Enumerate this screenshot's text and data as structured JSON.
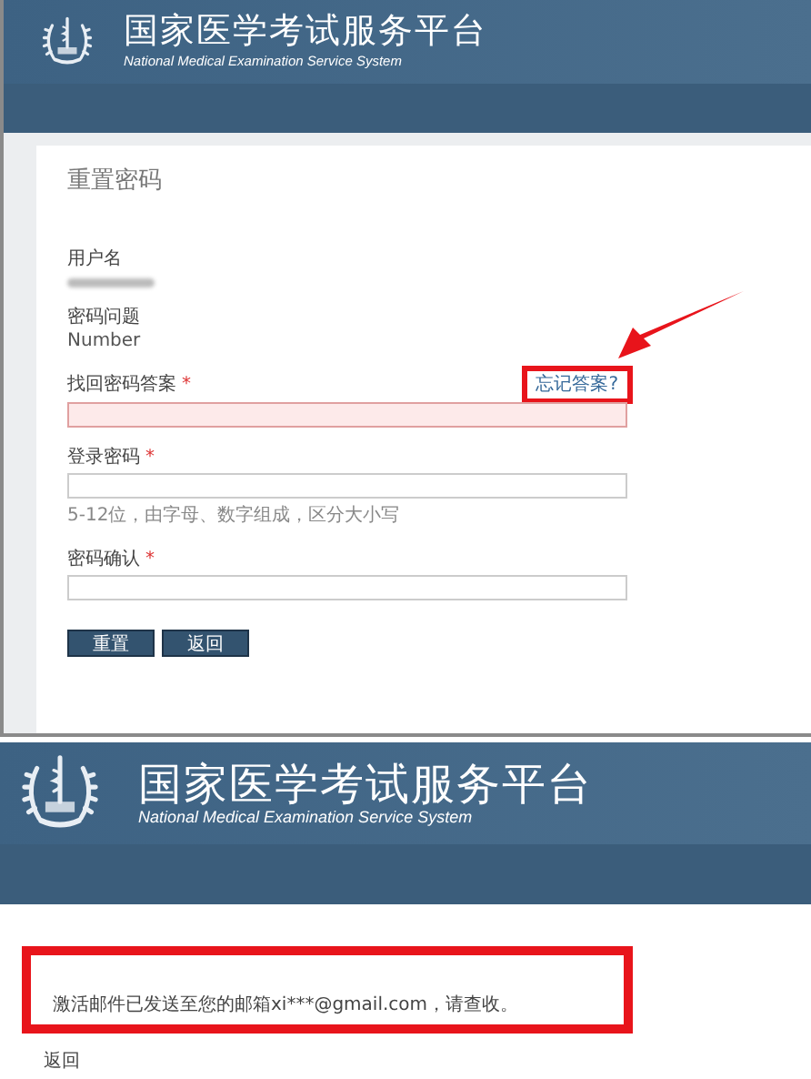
{
  "reset_page": {
    "header": {
      "title": "国家医学考试服务平台",
      "subtitle": "National Medical Examination Service System"
    },
    "heading": "重置密码",
    "fields": [
      {
        "kind": "redacted",
        "label": "用户名"
      },
      {
        "kind": "info",
        "label": "密码问题",
        "value": "Number"
      },
      {
        "kind": "input",
        "label": "找回密码答案",
        "mark": "*",
        "invalid": true,
        "link": "忘记答案?",
        "link_highlighted": true
      },
      {
        "kind": "input",
        "label": "登录密码",
        "mark": "*",
        "invalid": false,
        "hint": "5-12位，由字母、数字组成，区分大小写"
      },
      {
        "kind": "input",
        "label": "密码确认",
        "mark": "*",
        "invalid": false
      }
    ],
    "buttons": [
      "重置",
      "返回"
    ]
  },
  "confirmation_page": {
    "header": {
      "title": "国家医学考试服务平台",
      "subtitle": "National Medical Examination Service System"
    },
    "message": "激活邮件已发送至您的邮箱xi***@gmail.com，请查收。",
    "message_highlighted": true,
    "back_link": "返回"
  }
}
